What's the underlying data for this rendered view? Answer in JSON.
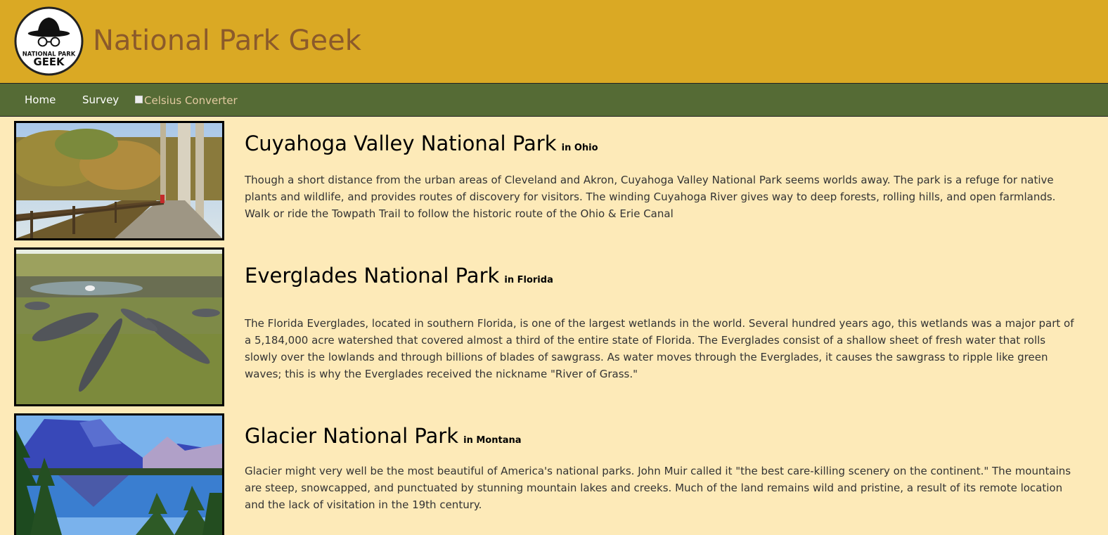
{
  "header": {
    "logo_text_top": "NATIONAL PARK",
    "logo_text_bottom": "GEEK",
    "title": "National Park Geek"
  },
  "nav": {
    "home": "Home",
    "survey": "Survey",
    "converter": "Celsius Converter"
  },
  "parks": [
    {
      "name": "Cuyahoga Valley National Park",
      "state": "in Ohio",
      "description": "Though a short distance from the urban areas of Cleveland and Akron, Cuyahoga Valley National Park seems worlds away. The park is a refuge for native plants and wildlife, and provides routes of discovery for visitors. The winding Cuyahoga River gives way to deep forests, rolling hills, and open farmlands. Walk or ride the Towpath Trail to follow the historic route of the Ohio & Erie Canal"
    },
    {
      "name": "Everglades National Park",
      "state": "in Florida",
      "description": "The Florida Everglades, located in southern Florida, is one of the largest wetlands in the world. Several hundred years ago, this wetlands was a major part of a 5,184,000 acre watershed that covered almost a third of the entire state of Florida. The Everglades consist of a shallow sheet of fresh water that rolls slowly over the lowlands and through billions of blades of sawgrass. As water moves through the Everglades, it causes the sawgrass to ripple like green waves; this is why the Everglades received the nickname \"River of Grass.\""
    },
    {
      "name": "Glacier National Park",
      "state": "in Montana",
      "description": "Glacier might very well be the most beautiful of America's national parks. John Muir called it \"the best care-killing scenery on the continent.\" The mountains are steep, snowcapped, and punctuated by stunning mountain lakes and creeks. Much of the land remains wild and pristine, a result of its remote location and the lack of visitation in the 19th century."
    }
  ]
}
